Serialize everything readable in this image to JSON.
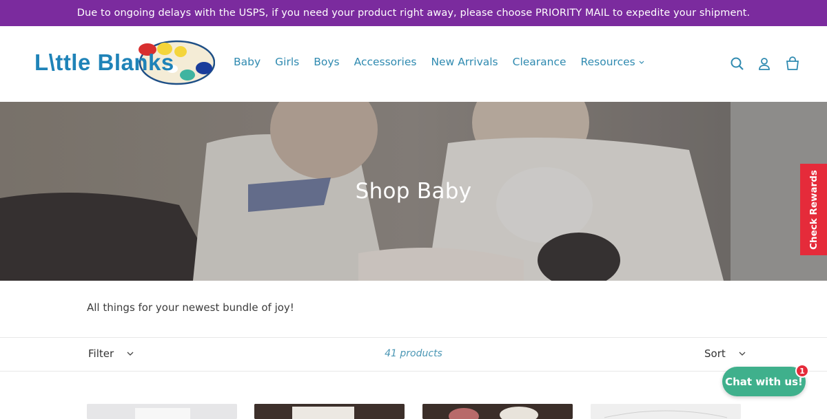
{
  "announcement": "Due to ongoing delays with the USPS, if you need your product right away, please choose PRIORITY MAIL to expedite your shipment.",
  "logo": {
    "text": "L\\ttle Blanks",
    "icon": "paint-palette-icon"
  },
  "nav": {
    "items": [
      "Baby",
      "Girls",
      "Boys",
      "Accessories",
      "New Arrivals",
      "Clearance",
      "Resources"
    ]
  },
  "header_icons": {
    "search": "search-icon",
    "account": "user-icon",
    "cart": "cart-icon"
  },
  "hero": {
    "title": "Shop Baby"
  },
  "rewards": {
    "label": "Check Rewards"
  },
  "collection": {
    "description": "All things for your newest bundle of joy!"
  },
  "toolbar": {
    "filter_label": "Filter",
    "product_count": "41 products",
    "sort_label": "Sort"
  },
  "chat": {
    "label": "Chat with us!",
    "badge": "1"
  },
  "colors": {
    "announcement_bg": "#7b2b9e",
    "accent": "#2f8ab0",
    "rewards_bg": "#e52b3a",
    "chat_bg": "#3fb08c"
  }
}
